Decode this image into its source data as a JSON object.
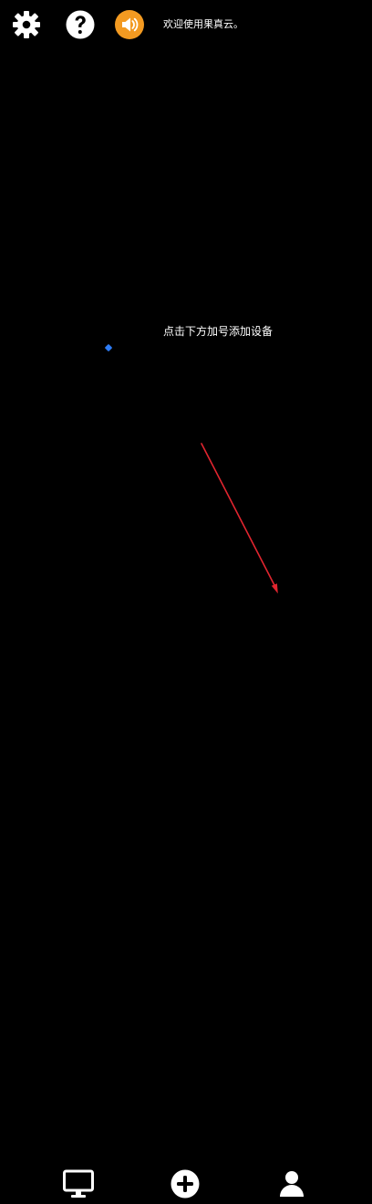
{
  "header": {
    "welcome_text": "欢迎使用果真云。"
  },
  "main": {
    "empty_hint": "点击下方加号添加设备"
  },
  "icons": {
    "settings": "gear-icon",
    "help": "question-circle-icon",
    "speaker": "speaker-icon",
    "devices": "monitor-icon",
    "add": "plus-circle-icon",
    "account": "user-icon",
    "guide": "arrow-icon"
  },
  "colors": {
    "background": "#000000",
    "foreground": "#ffffff",
    "speaker_accent": "#f39a21",
    "marker_blue": "#2d7cf6",
    "guide_red": "#e1252f"
  }
}
